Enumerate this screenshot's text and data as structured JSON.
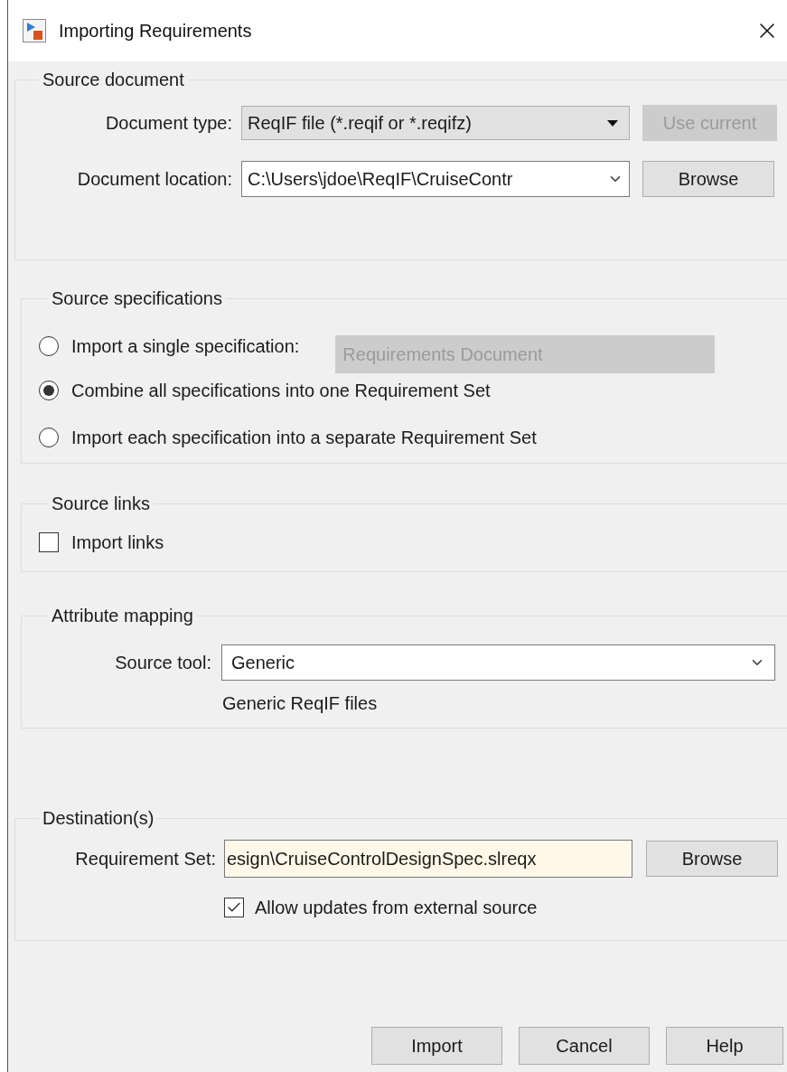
{
  "window": {
    "title": "Importing Requirements"
  },
  "source_document": {
    "title": "Source document",
    "document_type": {
      "label": "Document type:",
      "value": "ReqIF file (*.reqif or *.reqifz)"
    },
    "use_current": {
      "label": "Use current",
      "disabled": true
    },
    "document_location": {
      "label": "Document location:",
      "value": "C:\\Users\\jdoe\\ReqIF\\CruiseContr"
    },
    "browse": "Browse"
  },
  "source_specifications": {
    "title": "Source specifications",
    "options": [
      {
        "label": "Import a single specification:",
        "selected": false
      },
      {
        "label": "Combine all specifications into one Requirement Set",
        "selected": true
      },
      {
        "label": "Import each specification into a separate Requirement Set",
        "selected": false
      }
    ],
    "single_specification": {
      "value": "Requirements Document",
      "disabled": true
    }
  },
  "source_links": {
    "title": "Source links",
    "import_links": {
      "label": "Import links",
      "checked": false
    }
  },
  "attribute_mapping": {
    "title": "Attribute mapping",
    "source_tool": {
      "label": "Source tool:",
      "value": "Generic"
    },
    "description": "Generic ReqIF files"
  },
  "destinations": {
    "title": "Destination(s)",
    "requirement_set": {
      "label": "Requirement Set:",
      "value": "esign\\CruiseControlDesignSpec.slreqx"
    },
    "browse": "Browse",
    "allow_updates": {
      "label": "Allow updates from external source",
      "checked": true
    }
  },
  "buttons": [
    "Import",
    "Cancel",
    "Help"
  ]
}
